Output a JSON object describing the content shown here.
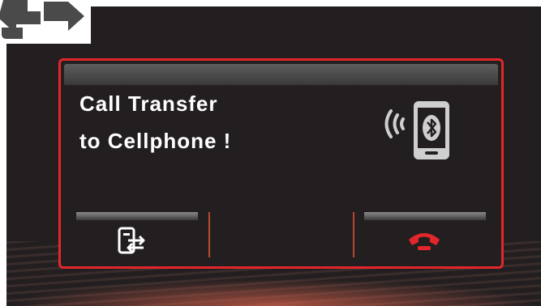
{
  "dialog": {
    "message_line1": "Call Transfer",
    "message_line2": "to Cellphone !"
  },
  "icons": {
    "corner": "transfer-arrows-icon",
    "status": "bluetooth-phone-icon",
    "transfer": "transfer-to-phone-icon",
    "end_call": "end-call-icon"
  },
  "colors": {
    "dialog_border": "#e3262b",
    "end_call": "#e3262b",
    "background": "#231f20"
  }
}
